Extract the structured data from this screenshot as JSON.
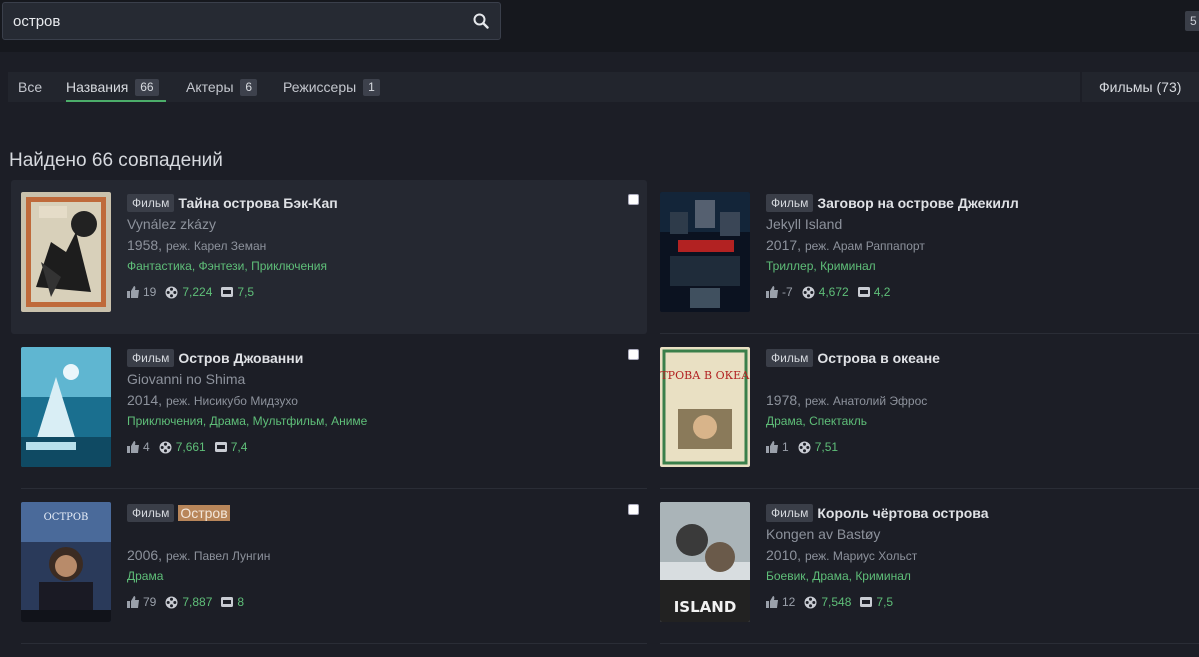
{
  "search": {
    "value": "остров"
  },
  "corner_badge": "5",
  "tabs": [
    {
      "label": "Все",
      "count": ""
    },
    {
      "label": "Названия",
      "count": "66"
    },
    {
      "label": "Актеры",
      "count": "6"
    },
    {
      "label": "Режиссеры",
      "count": "1"
    }
  ],
  "films_tab": "Фильмы (73)",
  "found_text": "Найдено 66 совпадений",
  "colors": {
    "accent": "#4cae6a",
    "highlight": "#b8865a",
    "bg": "#1c1e26"
  },
  "results": [
    {
      "type": "Фильм",
      "title": "Тайна острова Бэк-Кап",
      "orig": "Vynález zkázy",
      "year": "1958,",
      "director": "реж. Карел Земан",
      "genres": [
        "Фантастика",
        "Фэнтези",
        "Приключения"
      ],
      "likes": "19",
      "kp": "7,224",
      "imdb": "7,5"
    },
    {
      "type": "Фильм",
      "title": "Заговор на острове Джекилл",
      "orig": "Jekyll Island",
      "year": "2017,",
      "director": "реж. Арам Раппапорт",
      "genres": [
        "Триллер",
        "Криминал"
      ],
      "likes": "-7",
      "kp": "4,672",
      "imdb": "4,2"
    },
    {
      "type": "Фильм",
      "title": "Остров Джованни",
      "orig": "Giovanni no Shima",
      "year": "2014,",
      "director": "реж. Нисикубо Мидзухо",
      "genres": [
        "Приключения",
        "Драма",
        "Мультфильм",
        "Аниме"
      ],
      "likes": "4",
      "kp": "7,661",
      "imdb": "7,4"
    },
    {
      "type": "Фильм",
      "title": "Острова в океане",
      "orig": "",
      "year": "1978,",
      "director": "реж. Анатолий Эфрос",
      "genres": [
        "Драма",
        "Спектакль"
      ],
      "likes": "1",
      "kp": "7,51",
      "imdb": ""
    },
    {
      "type": "Фильм",
      "title": "Остров",
      "orig": "",
      "year": "2006,",
      "director": "реж. Павел Лунгин",
      "genres": [
        "Драма"
      ],
      "likes": "79",
      "kp": "7,887",
      "imdb": "8"
    },
    {
      "type": "Фильм",
      "title": "Король чёртова острова",
      "orig": "Kongen av Bastøy",
      "year": "2010,",
      "director": "реж. Мариус Хольст",
      "genres": [
        "Боевик",
        "Драма",
        "Криминал"
      ],
      "likes": "12",
      "kp": "7,548",
      "imdb": "7,5"
    }
  ],
  "poster_texts": {
    "p4_title": "ОСТРОВА В ОКЕАНЕ",
    "p5_title": "ОСТРОВ",
    "p6_title": "ISLAND"
  }
}
